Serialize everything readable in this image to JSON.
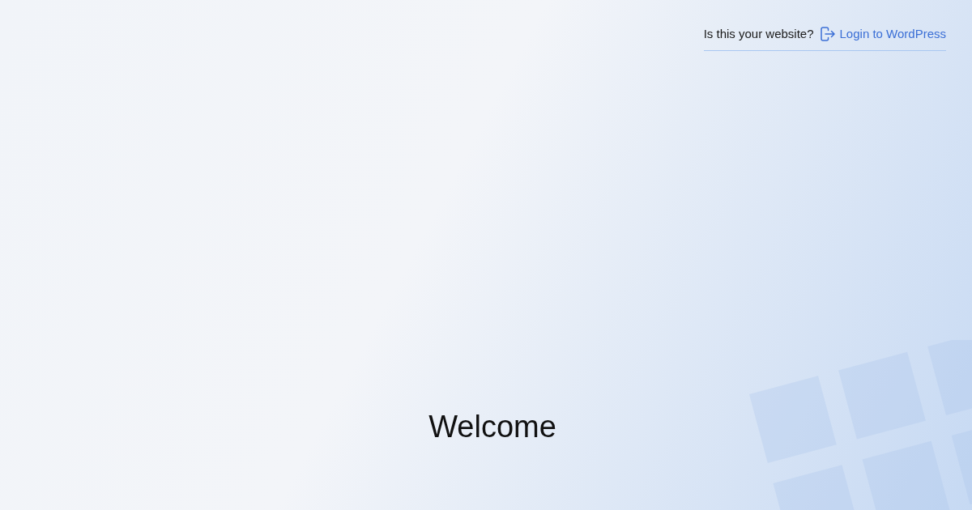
{
  "header": {
    "question": "Is this your website?",
    "login_link": "Login to WordPress"
  },
  "welcome": {
    "heading": "Welcome"
  }
}
